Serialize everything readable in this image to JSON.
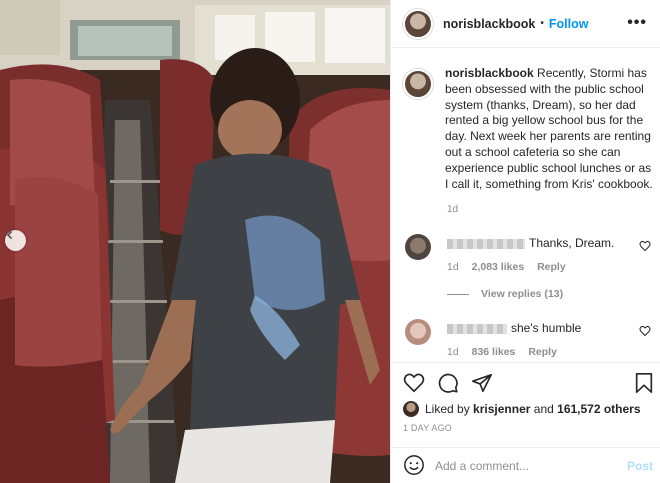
{
  "post": {
    "username": "norisblackbook",
    "follow_label": "Follow",
    "separator": "•",
    "more_label": "•••",
    "caption": "Recently, Stormi has been obsessed with the public school system (thanks, Dream), so her dad rented a big yellow school bus for the day. Next week her parents are renting out a school cafeteria so she can experience public school lunches or as I call it, something from Kris' cookbook.",
    "caption_time": "1d"
  },
  "comments": [
    {
      "text": "Thanks, Dream.",
      "time": "1d",
      "likes": "2,083 likes",
      "reply": "Reply"
    },
    {
      "text": "she's humble",
      "time": "1d",
      "likes": "836 likes",
      "reply": "Reply"
    }
  ],
  "view_replies": "View replies (13)",
  "likes": {
    "prefix": "Liked by",
    "user": "krisjenner",
    "joiner": "and",
    "count": "161,572 others"
  },
  "post_date": "1 DAY AGO",
  "add_comment": {
    "placeholder": "Add a comment...",
    "post_label": "Post"
  },
  "icons": [
    "chevron-left-icon",
    "more-icon",
    "heart-icon",
    "comment-icon",
    "share-icon",
    "bookmark-icon",
    "emoji-icon"
  ],
  "colors": {
    "link": "#0095f6",
    "post_disabled": "#b2dffc",
    "meta": "#8e8e8e",
    "text": "#262626"
  }
}
